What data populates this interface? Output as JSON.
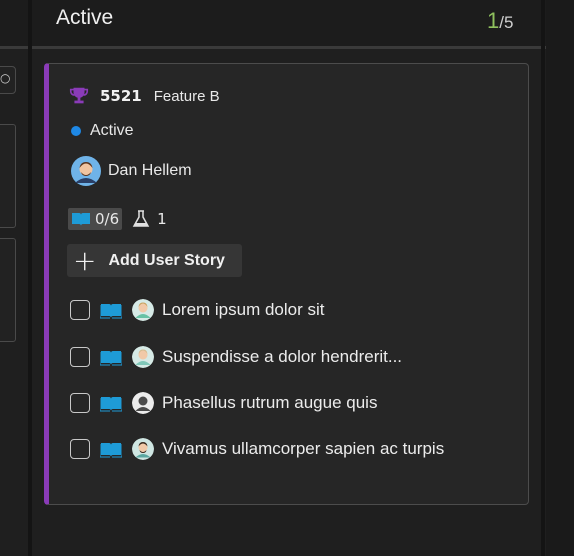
{
  "column": {
    "title": "Active",
    "wip_current": "1",
    "wip_total": "/5"
  },
  "card": {
    "work_item_type_icon": "trophy-icon",
    "id": "5521",
    "title": "Feature B",
    "state": "Active",
    "state_color": "#1e88e5",
    "assigned_to": "Dan Hellem",
    "accent_color": "#8a3bb8",
    "child_progress": "0/6",
    "test_count": "1",
    "add_button_label": "Add User Story",
    "stories": [
      {
        "title": "Lorem ipsum dolor sit"
      },
      {
        "title": "Suspendisse a dolor hendrerit..."
      },
      {
        "title": "Phasellus rutrum augue quis"
      },
      {
        "title": "Vivamus ullamcorper sapien ac turpis"
      }
    ]
  }
}
